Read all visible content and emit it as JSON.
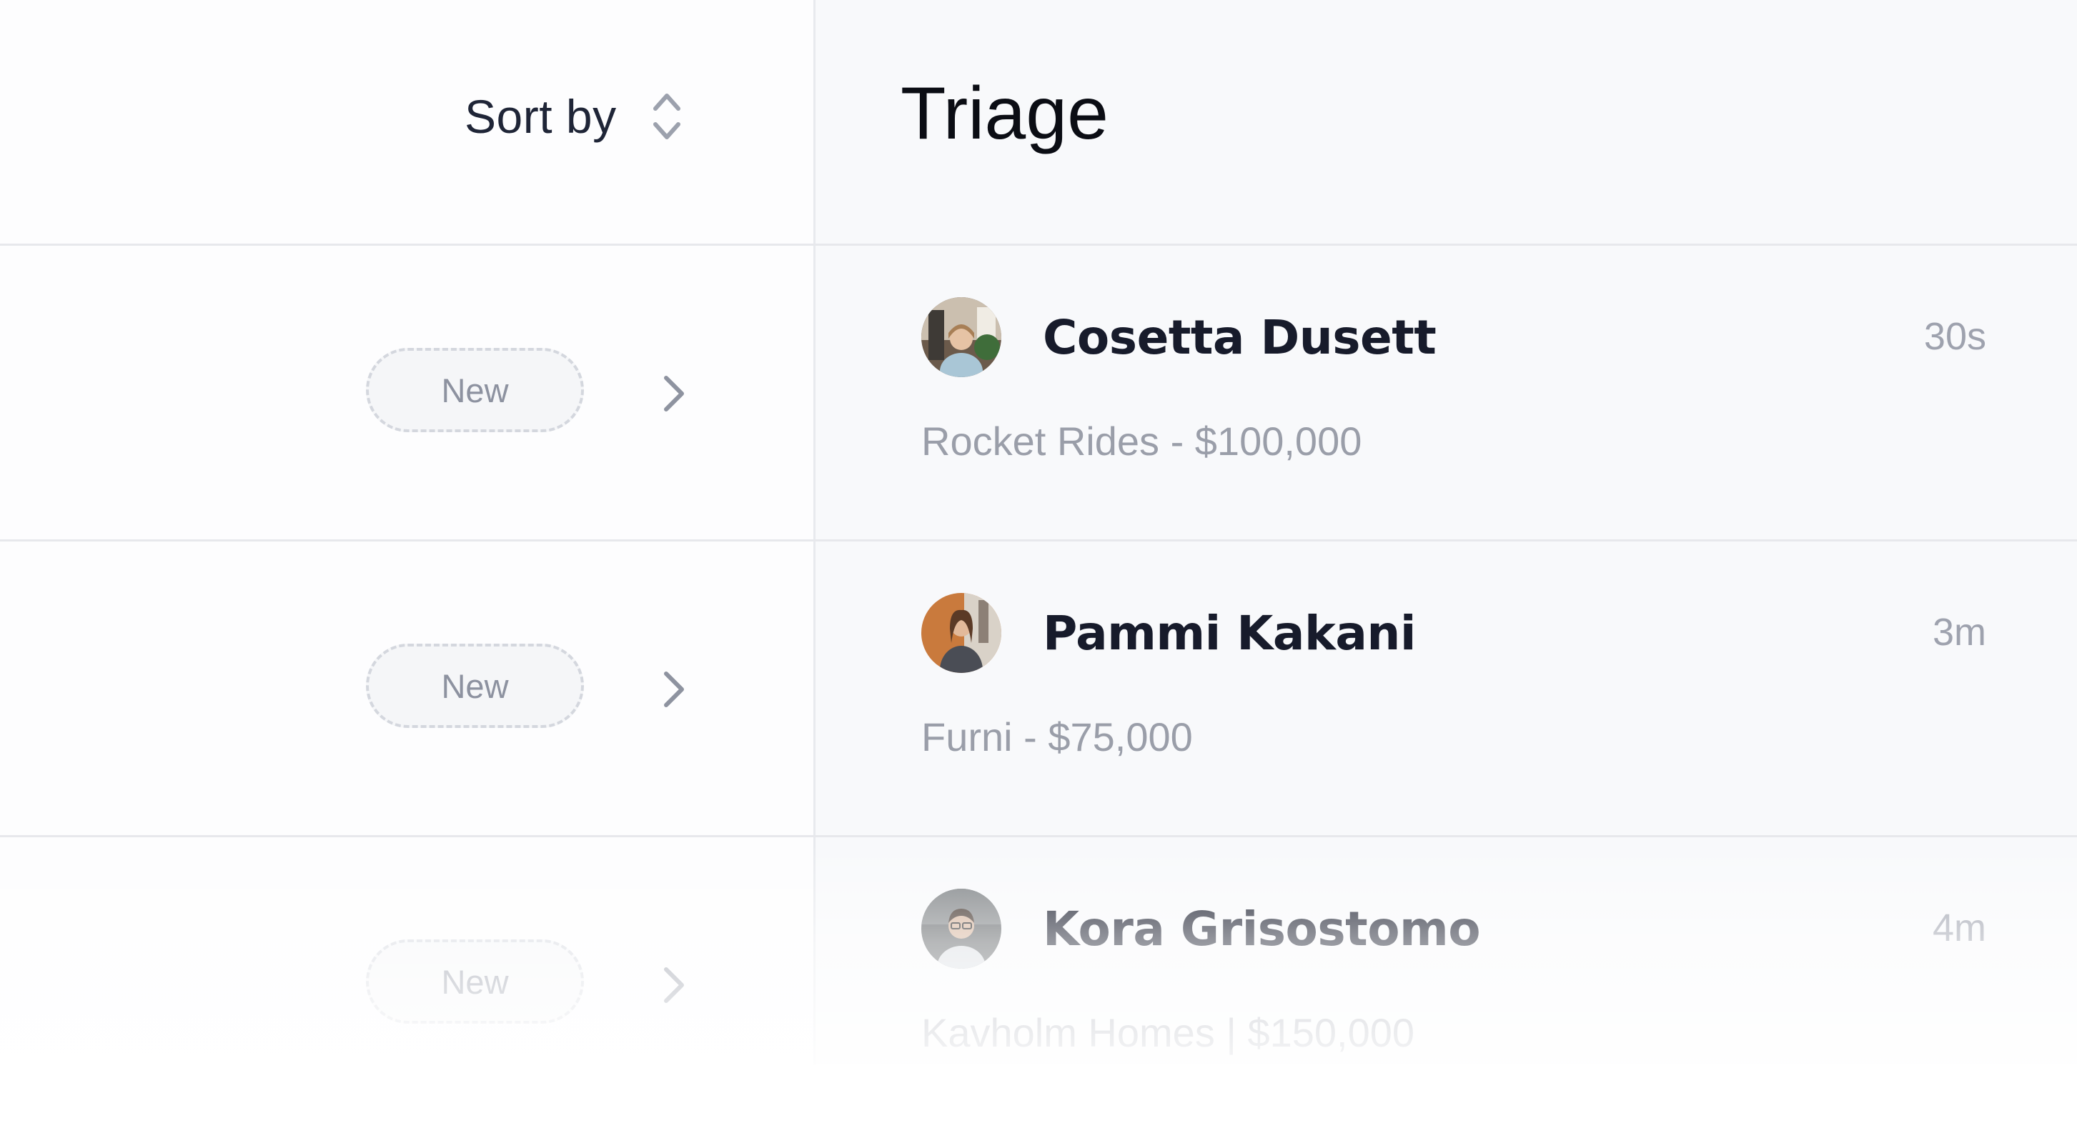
{
  "header": {
    "sort_label": "Sort by",
    "title": "Triage"
  },
  "icons": {
    "sort": "sort-updown-icon",
    "row_action": "chevron-right-icon"
  },
  "colors": {
    "title": "#0b0d14",
    "name": "#171b2b",
    "muted": "#9a9ea9",
    "badge_border": "#d4d7de",
    "right_pane_bg": "#f8f9fb"
  },
  "rows": [
    {
      "status": "New",
      "name": "Cosetta Dusett",
      "time": "30s",
      "meta": "Rocket Rides - $100,000"
    },
    {
      "status": "New",
      "name": "Pammi Kakani",
      "time": "3m",
      "meta": "Furni - $75,000"
    },
    {
      "status": "New",
      "name": "Kora Grisostomo",
      "time": "4m",
      "meta": "Kavholm Homes | $150,000"
    }
  ]
}
